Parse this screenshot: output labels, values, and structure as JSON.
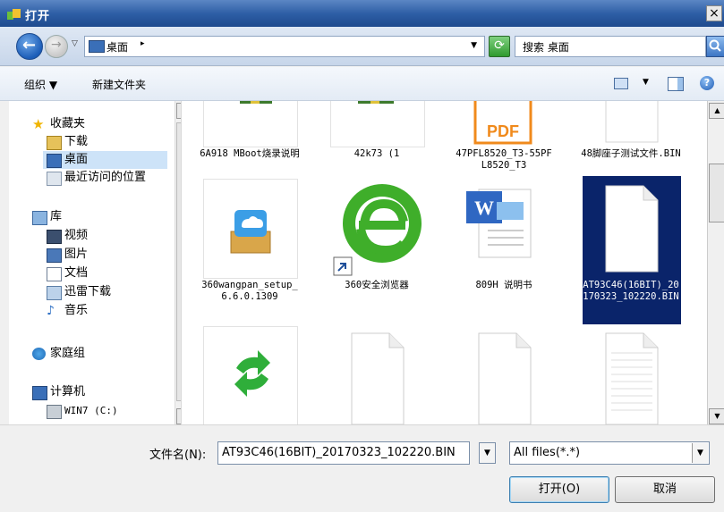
{
  "window": {
    "title": "打开"
  },
  "address": {
    "crumb": "桌面",
    "search_placeholder": "搜索 桌面"
  },
  "toolbar": {
    "organize": "组织 ▼",
    "new_folder": "新建文件夹"
  },
  "nav": {
    "favorites": "收藏夹",
    "downloads": "下载",
    "desktop": "桌面",
    "recent": "最近访问的位置",
    "libraries": "库",
    "videos": "视频",
    "pictures": "图片",
    "documents": "文档",
    "thunder": "迅雷下载",
    "music": "音乐",
    "homegroup": "家庭组",
    "computer": "计算机",
    "drive_c": "WIN7 (C:)"
  },
  "files": [
    {
      "name": "6A918 MBoot烧录说明",
      "icon": "rar-icon"
    },
    {
      "name": "42k73 (1",
      "icon": "rar-icon"
    },
    {
      "name": "47PFL8520_T3-55PFL8520_T3",
      "icon": "pdf-icon"
    },
    {
      "name": "48脚座子测试文件.BIN",
      "icon": "file-icon"
    },
    {
      "name": "360wangpan_setup_6.6.0.1309",
      "icon": "cloud-installer-icon"
    },
    {
      "name": "360安全浏览器",
      "icon": "browser-360-icon"
    },
    {
      "name": "809H 说明书",
      "icon": "word-icon"
    },
    {
      "name": "AT93C46(16BIT)_20170323_102220.BIN",
      "icon": "file-icon",
      "selected": true
    },
    {
      "name": "",
      "icon": "refresh-green-icon"
    },
    {
      "name": "",
      "icon": "file-icon"
    },
    {
      "name": "",
      "icon": "file-icon"
    },
    {
      "name": "",
      "icon": "text-file-icon"
    }
  ],
  "bottom": {
    "filename_label": "文件名(N):",
    "filename_value": "AT93C46(16BIT)_20170323_102220.BIN",
    "filter": "All files(*.*)",
    "open": "打开(O)",
    "cancel": "取消"
  },
  "colors": {
    "selection": "#0a246a",
    "titlebar": "#2e5fa6"
  }
}
